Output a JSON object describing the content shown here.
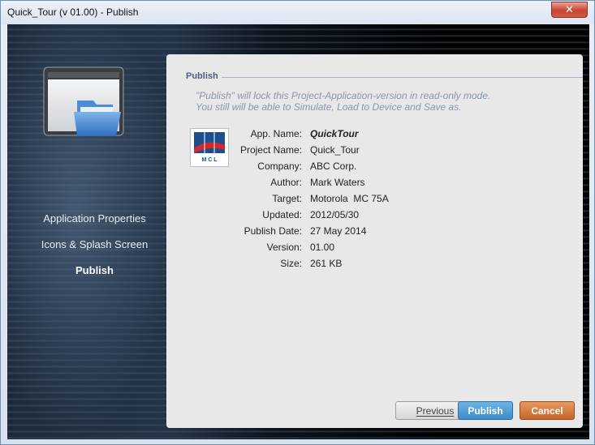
{
  "window": {
    "title": "Quick_Tour (v 01.00) - Publish"
  },
  "sidebar": {
    "items": [
      {
        "label": "Application Properties",
        "active": false
      },
      {
        "label": "Icons & Splash Screen",
        "active": false
      },
      {
        "label": "Publish",
        "active": true
      }
    ]
  },
  "panel": {
    "section_title": "Publish",
    "description_line1": "\"Publish\" will lock this Project-Application-version in read-only mode.",
    "description_line2": "You still will be able to Simulate, Load to Device and Save as.",
    "logo_text": "M C L",
    "fields": [
      {
        "label": "App. Name:",
        "value": "QuickTour"
      },
      {
        "label": "Project Name:",
        "value": "Quick_Tour"
      },
      {
        "label": "Company:",
        "value": "ABC Corp."
      },
      {
        "label": "Author:",
        "value": "Mark Waters"
      },
      {
        "label": "Target:",
        "value": "Motorola  MC 75A"
      },
      {
        "label": "Updated:",
        "value": "2012/05/30"
      },
      {
        "label": "Publish Date:",
        "value": "27 May 2014"
      },
      {
        "label": "Version:",
        "value": "01.00"
      },
      {
        "label": "Size:",
        "value": "261 KB"
      }
    ]
  },
  "buttons": {
    "previous": "Previous",
    "publish": "Publish",
    "cancel": "Cancel"
  },
  "colors": {
    "publish_button": "#3c8cc9",
    "cancel_button": "#c8652a",
    "section_title": "#4b5f7a",
    "description": "#8a96a8"
  }
}
